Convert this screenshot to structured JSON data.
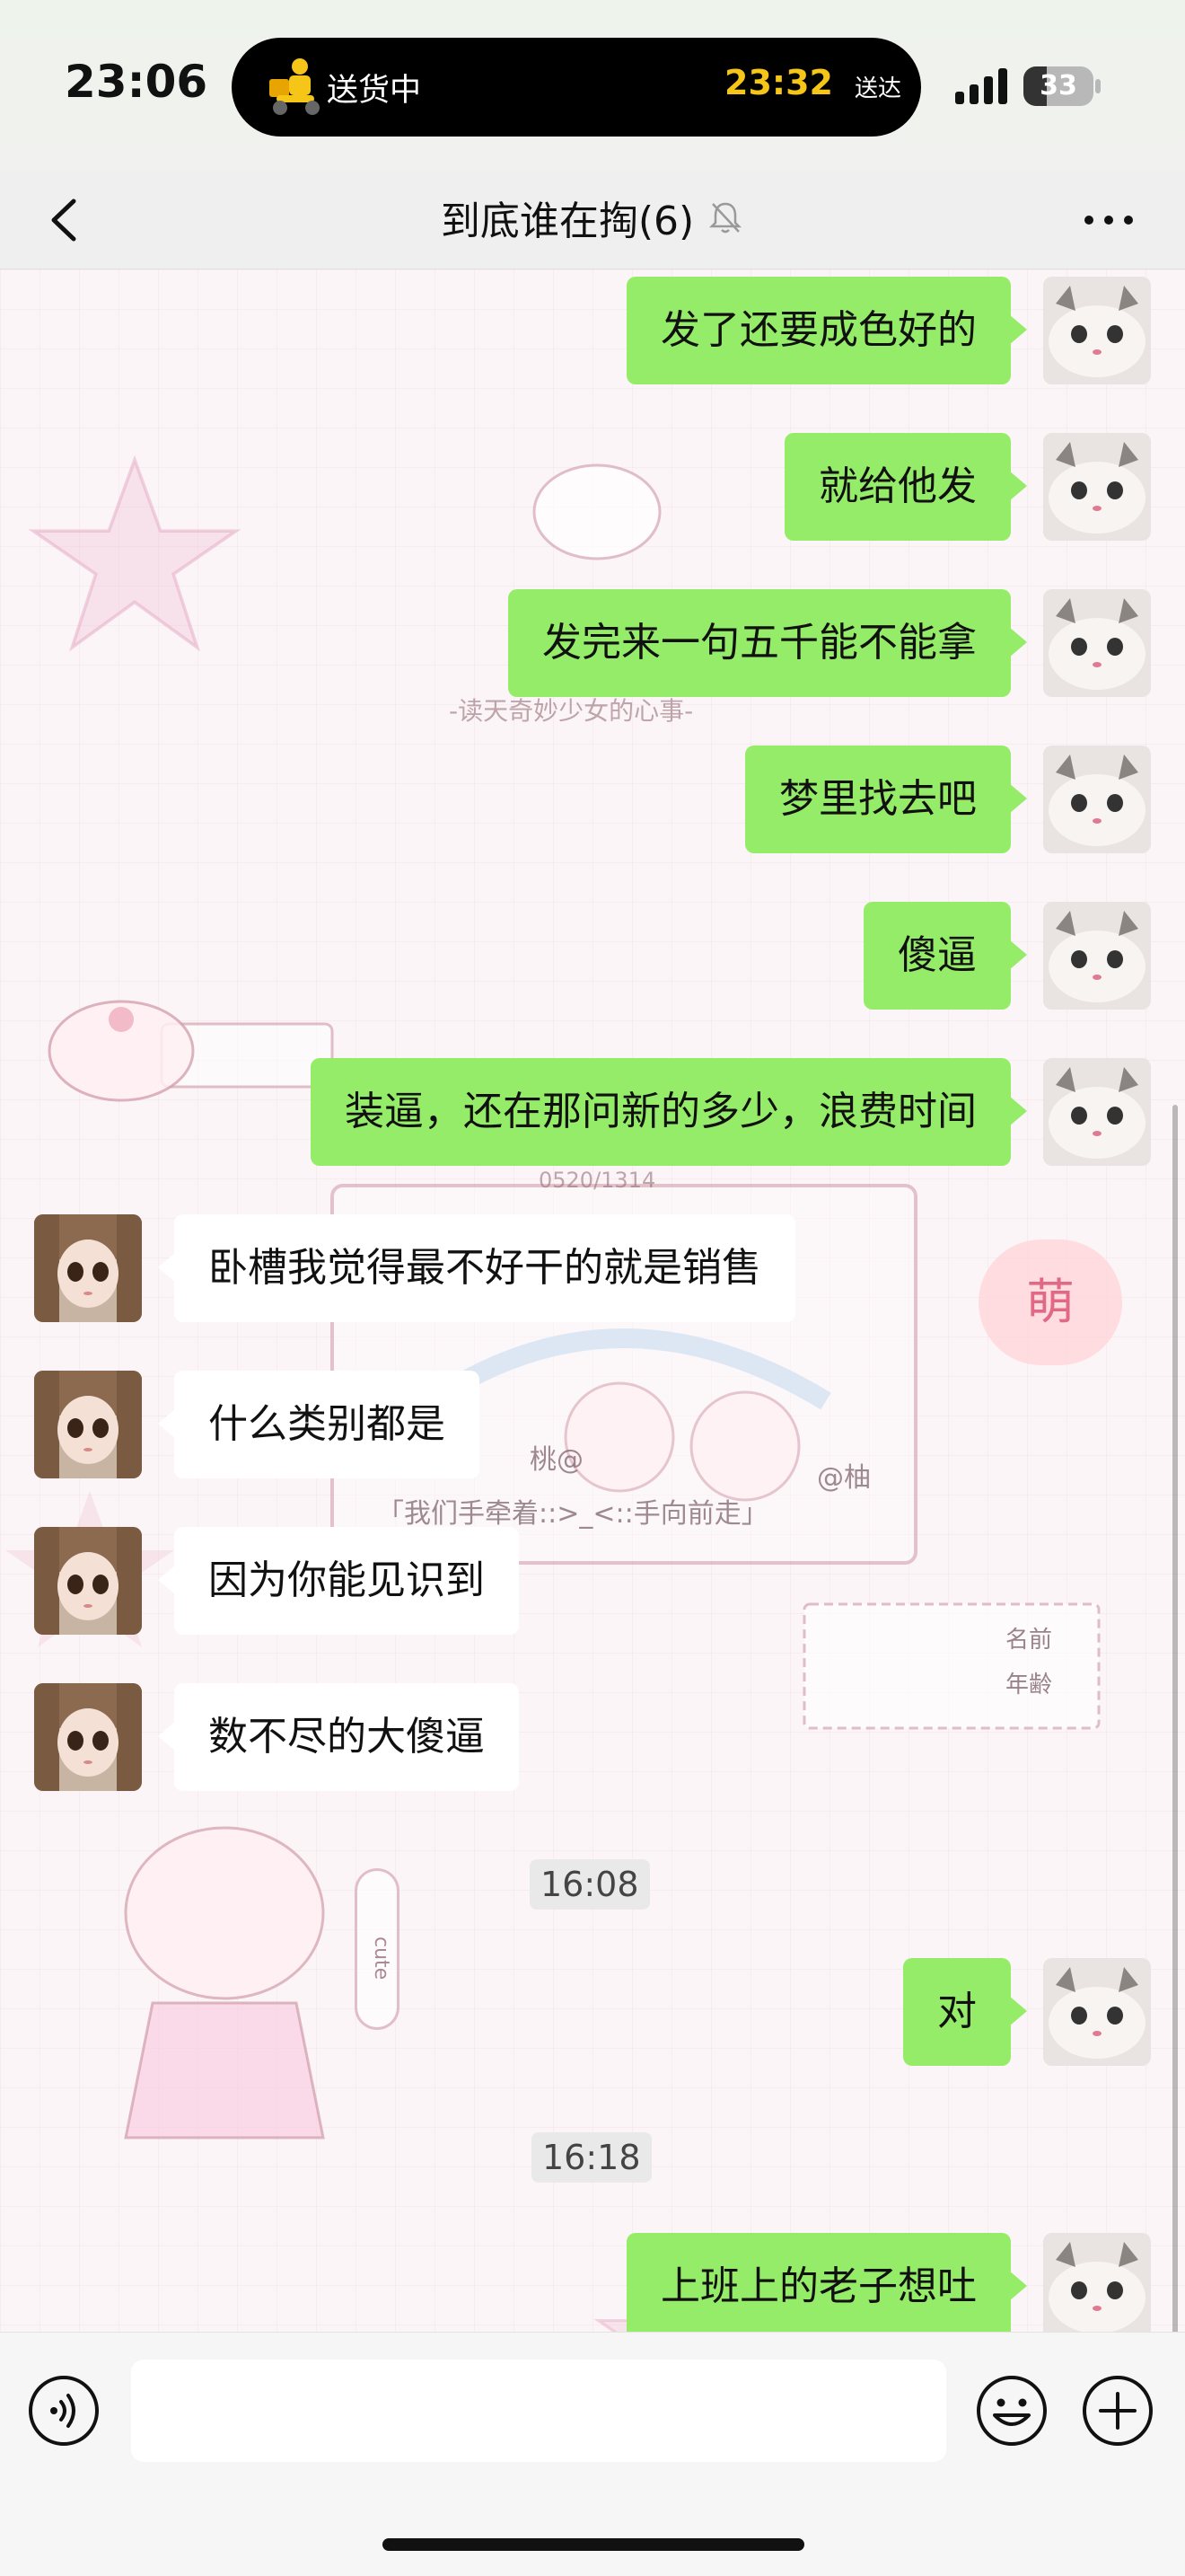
{
  "status_bar": {
    "time": "23:06",
    "live_activity": {
      "label": "送货中",
      "eta": "23:32",
      "eta_label": "送达"
    },
    "battery": "33",
    "battery_level": 0.33
  },
  "nav": {
    "title": "到底谁在掏(6)",
    "muted": true
  },
  "messages": [
    {
      "from": "me",
      "text": "发了还要成色好的"
    },
    {
      "from": "me",
      "text": "就给他发"
    },
    {
      "from": "me",
      "text": "发完来一句五千能不能拿"
    },
    {
      "from": "me",
      "text": "梦里找去吧"
    },
    {
      "from": "me",
      "text": "傻逼"
    },
    {
      "from": "me",
      "text": "装逼，还在那问新的多少，浪费时间"
    },
    {
      "from": "other",
      "text": "卧槽我觉得最不好干的就是销售"
    },
    {
      "from": "other",
      "text": "什么类别都是"
    },
    {
      "from": "other",
      "text": "因为你能见识到"
    },
    {
      "from": "other",
      "text": "数不尽的大傻逼"
    },
    {
      "type": "time",
      "text": "16:08"
    },
    {
      "from": "me",
      "text": "对"
    },
    {
      "type": "time",
      "text": "16:18"
    },
    {
      "from": "me",
      "text": "上班上的老子想吐"
    }
  ],
  "wallpaper": {
    "sticker_texts": [
      "-读天奇妙少女的心事-",
      "萌",
      "桃@",
      "@柚",
      "「我们手牵着::>_<::手向前走」",
      "名前",
      "年齢",
      "cute",
      "0520/1314"
    ]
  },
  "input_bar": {
    "placeholder": ""
  },
  "colors": {
    "my_bubble": "#95ec69",
    "their_bubble": "#ffffff",
    "eta": "#f5c518"
  },
  "icons": [
    "back-arrow-icon",
    "mute-bell-icon",
    "more-dots-icon",
    "voice-icon",
    "emoji-icon",
    "plus-icon",
    "delivery-rider-icon",
    "signal-icon",
    "battery-icon"
  ]
}
